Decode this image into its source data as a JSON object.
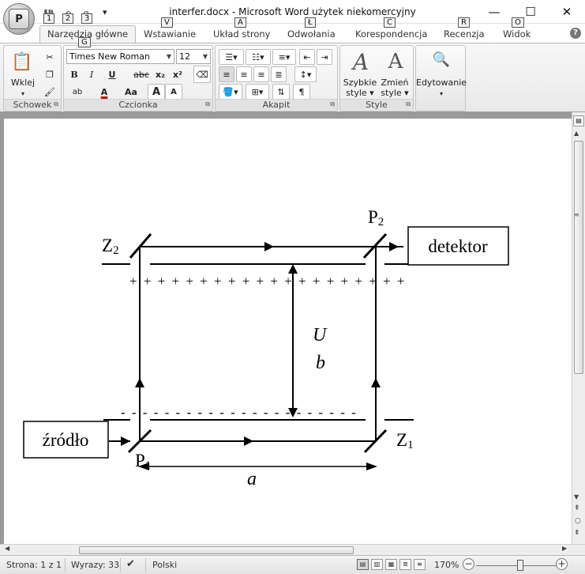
{
  "titlebar": {
    "title": "interfer.docx - Microsoft Word użytek niekomercyjny",
    "office_button_label": "P",
    "qat_keytips": [
      "1",
      "2",
      "3"
    ],
    "qat_more": "▾",
    "minimize": "—",
    "maximize": "☐",
    "close": "✕"
  },
  "tabs": [
    {
      "label": "Narzędzia główne",
      "keytip": "G"
    },
    {
      "label": "Wstawianie",
      "keytip": "V"
    },
    {
      "label": "Układ strony",
      "keytip": "A"
    },
    {
      "label": "Odwołania",
      "keytip": "Ł"
    },
    {
      "label": "Korespondencja",
      "keytip": "C"
    },
    {
      "label": "Recenzja",
      "keytip": "R"
    },
    {
      "label": "Widok",
      "keytip": "O"
    }
  ],
  "ribbon": {
    "clipboard": {
      "group_label": "Schowek",
      "paste_label": "Wklej",
      "paste_arrow": "▾"
    },
    "font": {
      "group_label": "Czcionka",
      "font_name": "Times New Roman",
      "font_size": "12",
      "bold": "B",
      "italic": "I",
      "underline": "U",
      "strike": "abc",
      "subscript": "x₂",
      "superscript": "x²",
      "change_case": "Aa",
      "grow": "A",
      "shrink": "A",
      "font_color": "A",
      "highlight": "ab"
    },
    "paragraph": {
      "group_label": "Akapit",
      "pilcrow": "¶"
    },
    "styles": {
      "group_label": "Style",
      "quick_styles": "Szybkie\nstyle ▾",
      "change_styles": "Zmień\nstyle ▾"
    },
    "editing": {
      "label": "Edytowanie",
      "arrow": "▾"
    }
  },
  "diagram": {
    "labels": {
      "z2": "Z",
      "z2_sub": "2",
      "p2": "P",
      "p2_sub": "2",
      "detector": "detektor",
      "source": "źródło",
      "p1": "P",
      "p1_sub": "1",
      "z1": "Z",
      "z1_sub": "1",
      "u": "U",
      "b": "b",
      "a": "a"
    },
    "plus_row": "+ + + + + + + + + + + + + + + + + + + +",
    "minus_row": "-  - - - - - - - - - - - - - - - - - - - - -"
  },
  "statusbar": {
    "page": "Strona: 1 z 1",
    "words": "Wyrazy: 33",
    "language": "Polski",
    "zoom": "170%"
  }
}
